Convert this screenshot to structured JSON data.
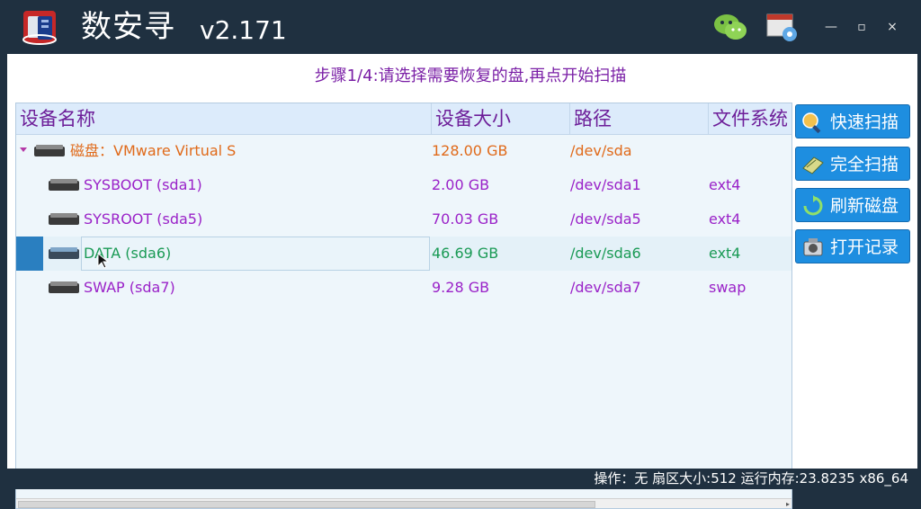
{
  "window": {
    "title": "数安寻",
    "version": "v2.171"
  },
  "step_title": "步骤1/4:请选择需要恢复的盘,再点开始扫描",
  "table": {
    "columns": [
      "设备名称",
      "设备大小",
      "路径",
      "文件系统"
    ],
    "disk": {
      "name": "磁盘：VMware Virtual S",
      "size": "128.00 GB",
      "path": "/dev/sda",
      "fs": ""
    },
    "partitions": [
      {
        "name": "SYSBOOT (sda1)",
        "size": "2.00 GB",
        "path": "/dev/sda1",
        "fs": "ext4"
      },
      {
        "name": "SYSROOT (sda5)",
        "size": "70.03 GB",
        "path": "/dev/sda5",
        "fs": "ext4"
      },
      {
        "name": "DATA (sda6)",
        "size": "46.69 GB",
        "path": "/dev/sda6",
        "fs": "ext4"
      },
      {
        "name": "SWAP (sda7)",
        "size": "9.28 GB",
        "path": "/dev/sda7",
        "fs": "swap"
      }
    ]
  },
  "buttons": {
    "quick_scan": "快速扫描",
    "full_scan": "完全扫描",
    "refresh_disk": "刷新磁盘",
    "open_record": "打开记录"
  },
  "status_bar": "操作：无 扇区大小:512 运行内存:23.8235 x86_64",
  "colors": {
    "title_bg": "#1f3040",
    "accent_purple": "#7a1fa6",
    "disk_orange": "#e06a1a",
    "selected_green": "#1a9a55",
    "button_blue": "#1e8ee0"
  },
  "icons": {
    "logo": "app-logo-icon",
    "wechat": "wechat-icon",
    "settings": "settings-window-icon"
  }
}
